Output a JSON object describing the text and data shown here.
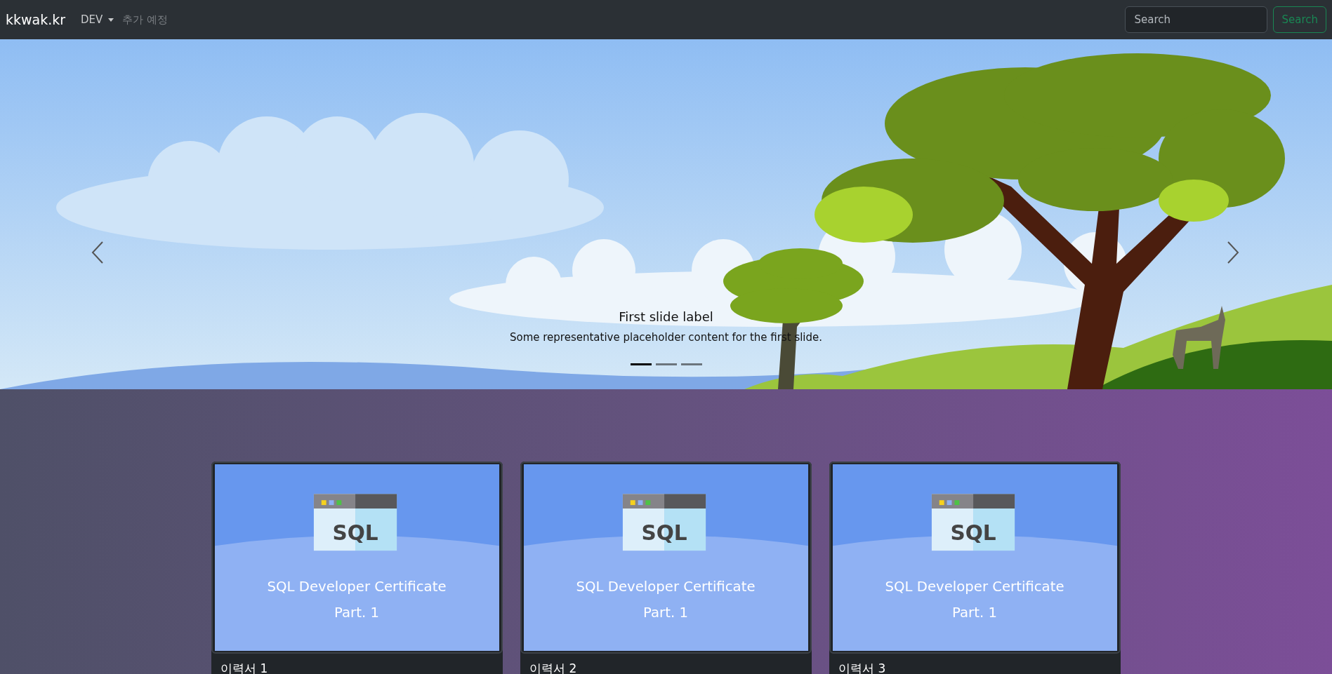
{
  "navbar": {
    "brand": "kkwak.kr",
    "items": [
      {
        "label": "DEV",
        "kind": "dropdown",
        "disabled": false
      },
      {
        "label": "추가 예정",
        "kind": "link",
        "disabled": true
      }
    ],
    "search": {
      "placeholder": "Search"
    },
    "search_button": "Search"
  },
  "carousel": {
    "caption": {
      "label": "First slide label",
      "text": "Some representative placeholder content for the first slide."
    },
    "indicators": [
      {
        "selected": true
      },
      {
        "selected": false
      },
      {
        "selected": false
      }
    ]
  },
  "cards": [
    {
      "image_icon_label": "SQL",
      "image_title": "SQL Developer Certificate",
      "image_subtitle": "Part. 1",
      "title": "이력서 1"
    },
    {
      "image_icon_label": "SQL",
      "image_title": "SQL Developer Certificate",
      "image_subtitle": "Part. 1",
      "title": "이력서 2"
    },
    {
      "image_icon_label": "SQL",
      "image_title": "SQL Developer Certificate",
      "image_subtitle": "Part. 1",
      "title": "이력서 3"
    }
  ]
}
